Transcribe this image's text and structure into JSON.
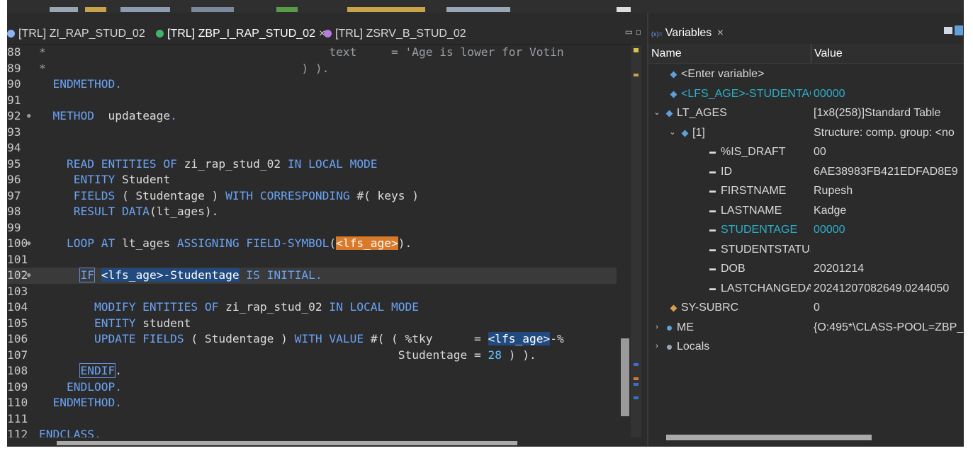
{
  "editor": {
    "tabs": [
      {
        "label": "[TRL] ZI_RAP_STUD_02",
        "icon": "interface-icon",
        "active": false
      },
      {
        "label": "[TRL] ZBP_I_RAP_STUD_02",
        "icon": "class-icon",
        "active": true,
        "close": "×"
      },
      {
        "label": "[TRL] ZSRV_B_STUD_02",
        "icon": "service-binding-icon",
        "active": false
      }
    ],
    "window_buttons": "▭ ▫",
    "lines": [
      {
        "n": "88",
        "fold": "",
        "segs": [
          [
            "cm",
            "*                                         text     = 'Age is lower for Votin"
          ]
        ]
      },
      {
        "n": "89",
        "fold": "",
        "segs": [
          [
            "cm",
            "*                                     ) )."
          ]
        ]
      },
      {
        "n": "90",
        "fold": "",
        "segs": [
          [
            "kw",
            "  ENDMETHOD."
          ]
        ]
      },
      {
        "n": "91",
        "fold": "",
        "segs": []
      },
      {
        "n": "92",
        "fold": "●",
        "segs": [
          [
            "kw",
            "  METHOD"
          ],
          [
            "",
            "  updateage"
          ],
          [
            "kw",
            "."
          ]
        ]
      },
      {
        "n": "93",
        "fold": "",
        "segs": []
      },
      {
        "n": "94",
        "fold": "",
        "segs": []
      },
      {
        "n": "95",
        "fold": "",
        "segs": [
          [
            "kw",
            "    READ ENTITIES OF"
          ],
          [
            "",
            " zi_rap_stud_02 "
          ],
          [
            "kw",
            "IN LOCAL MODE"
          ]
        ]
      },
      {
        "n": "96",
        "fold": "",
        "segs": [
          [
            "kw",
            "     ENTITY"
          ],
          [
            "",
            " Student"
          ]
        ]
      },
      {
        "n": "97",
        "fold": "",
        "segs": [
          [
            "kw",
            "     FIELDS"
          ],
          [
            "",
            " ( Studentage ) "
          ],
          [
            "kw",
            "WITH CORRESPONDING"
          ],
          [
            "",
            " #( keys )"
          ]
        ]
      },
      {
        "n": "98",
        "fold": "",
        "segs": [
          [
            "kw",
            "     RESULT DATA"
          ],
          [
            "",
            "(lt_ages)."
          ]
        ]
      },
      {
        "n": "99",
        "fold": "",
        "segs": []
      },
      {
        "n": "100",
        "fold": "●",
        "segs": [
          [
            "kw",
            "    LOOP AT"
          ],
          [
            "",
            " lt_ages "
          ],
          [
            "kw",
            "ASSIGNING FIELD-SYMBOL"
          ],
          [
            "",
            "("
          ],
          [
            "hl-orange",
            "<lfs_age>"
          ],
          [
            "",
            ")."
          ]
        ]
      },
      {
        "n": "101",
        "fold": "",
        "segs": []
      },
      {
        "n": "102",
        "fold": "●",
        "segs": [
          [
            "",
            "      "
          ],
          [
            "kw box",
            "IF"
          ],
          [
            "",
            " "
          ],
          [
            "hl-blue",
            "<lfs_age>-Studentage"
          ],
          [
            "kw",
            " IS INITIAL."
          ]
        ]
      },
      {
        "n": "103",
        "fold": "",
        "segs": []
      },
      {
        "n": "104",
        "fold": "",
        "segs": [
          [
            "kw",
            "        MODIFY ENTITIES OF"
          ],
          [
            "",
            " zi_rap_stud_02 "
          ],
          [
            "kw",
            "IN LOCAL MODE"
          ]
        ]
      },
      {
        "n": "105",
        "fold": "",
        "segs": [
          [
            "kw",
            "        ENTITY"
          ],
          [
            "",
            " student"
          ]
        ]
      },
      {
        "n": "106",
        "fold": "",
        "segs": [
          [
            "kw",
            "        UPDATE FIELDS"
          ],
          [
            "",
            " ( Studentage ) "
          ],
          [
            "kw",
            "WITH VALUE"
          ],
          [
            "",
            " #( ( %tky      = "
          ],
          [
            "hl-blue",
            "<lfs_age>"
          ],
          [
            "",
            "-%"
          ]
        ]
      },
      {
        "n": "107",
        "fold": "",
        "segs": [
          [
            "",
            "                                                    Studentage = "
          ],
          [
            "num",
            "28"
          ],
          [
            "",
            " ) )."
          ]
        ]
      },
      {
        "n": "108",
        "fold": "",
        "segs": [
          [
            "",
            "      "
          ],
          [
            "kw box",
            "ENDIF"
          ],
          [
            "",
            "."
          ]
        ]
      },
      {
        "n": "109",
        "fold": "",
        "segs": [
          [
            "kw",
            "    ENDLOOP."
          ]
        ]
      },
      {
        "n": "110",
        "fold": "",
        "segs": [
          [
            "kw",
            "  ENDMETHOD."
          ]
        ]
      },
      {
        "n": "111",
        "fold": "",
        "segs": []
      },
      {
        "n": "112",
        "fold": "",
        "segs": [
          [
            "kw",
            "ENDCLASS."
          ]
        ]
      }
    ]
  },
  "variables": {
    "tab_label": "Variables",
    "tab_prefix": "(x)=",
    "tab_close": "×",
    "columns": {
      "name": "Name",
      "value": "Value"
    },
    "rows": [
      {
        "name": "<Enter variable>",
        "value": "",
        "indent": 0,
        "twisty": "",
        "icon": "variable-icon",
        "changed": false
      },
      {
        "name": "<LFS_AGE>-STUDENTAGE",
        "value": "00000",
        "indent": 0,
        "twisty": "",
        "icon": "variable-icon",
        "changed": true
      },
      {
        "name": "LT_AGES",
        "value": "[1x8(258)]Standard Table",
        "indent": 0,
        "twisty": "⌄",
        "icon": "variable-icon",
        "changed": false
      },
      {
        "name": "[1]",
        "value": "Structure: comp. group: <no",
        "indent": 1,
        "twisty": "⌄",
        "icon": "variable-icon",
        "changed": false
      },
      {
        "name": "%IS_DRAFT",
        "value": "00",
        "indent": 2,
        "twisty": "",
        "icon": "field-icon",
        "changed": false
      },
      {
        "name": "ID",
        "value": "6AE38983FB421EDFAD8E9",
        "indent": 2,
        "twisty": "",
        "icon": "field-icon",
        "changed": false
      },
      {
        "name": "FIRSTNAME",
        "value": "Rupesh",
        "indent": 2,
        "twisty": "",
        "icon": "field-icon",
        "changed": false
      },
      {
        "name": "LASTNAME",
        "value": "Kadge",
        "indent": 2,
        "twisty": "",
        "icon": "field-icon",
        "changed": false
      },
      {
        "name": "STUDENTAGE",
        "value": "00000",
        "indent": 2,
        "twisty": "",
        "icon": "field-icon",
        "changed": true
      },
      {
        "name": "STUDENTSTATUS",
        "value": "",
        "indent": 2,
        "twisty": "",
        "icon": "field-icon",
        "changed": false
      },
      {
        "name": "DOB",
        "value": "20201214",
        "indent": 2,
        "twisty": "",
        "icon": "field-icon",
        "changed": false
      },
      {
        "name": "LASTCHANGEDAT",
        "value": "20241207082649.0244050",
        "indent": 2,
        "twisty": "",
        "icon": "field-icon",
        "changed": false
      },
      {
        "name": "SY-SUBRC",
        "value": "0",
        "indent": 0,
        "twisty": "",
        "icon": "system-variable-icon",
        "changed": false
      },
      {
        "name": "ME",
        "value": "{O:495*\\CLASS-POOL=ZBP_",
        "indent": 0,
        "twisty": "›",
        "icon": "object-icon",
        "changed": false
      },
      {
        "name": "Locals",
        "value": "",
        "indent": 0,
        "twisty": "›",
        "icon": "locals-icon",
        "changed": false
      }
    ]
  },
  "colors": {
    "keyword": "#6aa3f5",
    "changed_value": "#2bb0c9",
    "highlight_orange": "#d9792a",
    "highlight_blue": "#214a80"
  }
}
